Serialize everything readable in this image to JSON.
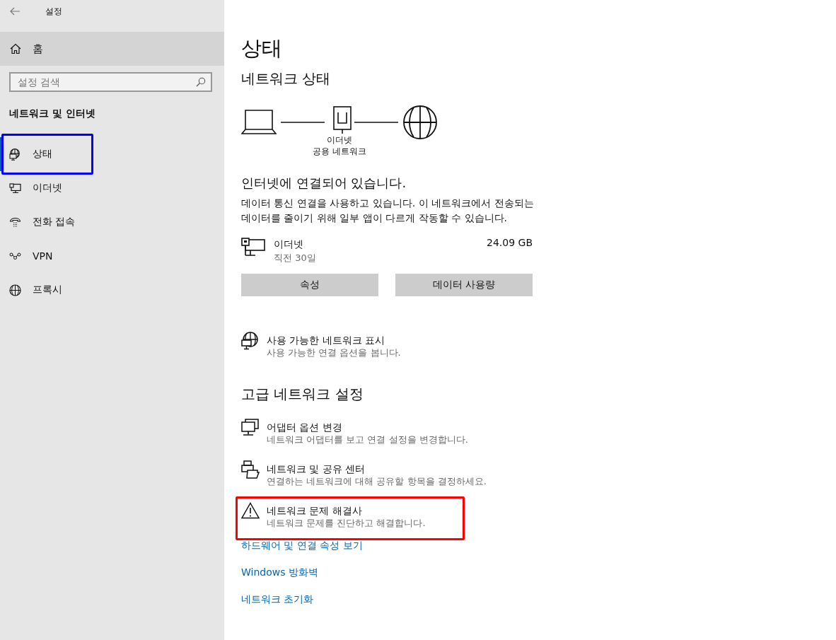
{
  "window": {
    "title": "설정"
  },
  "sidebar": {
    "home": {
      "label": "홈",
      "selected": true
    },
    "search": {
      "placeholder": "설정 검색"
    },
    "section_title": "네트워크 및 인터넷",
    "items": [
      {
        "label": "상태",
        "kind": "status",
        "selected": true,
        "highlighted": true
      },
      {
        "label": "이더넷",
        "kind": "ethernet",
        "selected": false,
        "highlighted": false
      },
      {
        "label": "전화 접속",
        "kind": "dialup",
        "selected": false,
        "highlighted": false
      },
      {
        "label": "VPN",
        "kind": "vpn",
        "selected": false,
        "highlighted": false
      },
      {
        "label": "프록시",
        "kind": "proxy",
        "selected": false,
        "highlighted": false
      }
    ]
  },
  "page": {
    "title": "상태",
    "network_status": {
      "heading": "네트워크 상태",
      "adapter_name": "이더넷",
      "network_type": "공용 네트워크",
      "connection_message": "인터넷에 연결되어 있습니다.",
      "description": "데이터 통신 연결을 사용하고 있습니다. 이 네트워크에서 전송되는 데이터를 줄이기 위해 일부 앱이 다르게 작동할 수 있습니다.",
      "usage": {
        "name": "이더넷",
        "period": "직전 30일",
        "amount": "24.09 GB"
      },
      "buttons": [
        "속성",
        "데이터 사용량"
      ]
    },
    "show_networks": {
      "title": "사용 가능한 네트워크 표시",
      "subtitle": "사용 가능한 연결 옵션을 봅니다."
    },
    "advanced": {
      "heading": "고급 네트워크 설정",
      "items": [
        {
          "kind": "adapter",
          "title": "어댑터 옵션 변경",
          "subtitle": "네트워크 어댑터를 보고 연결 설정을 변경합니다.",
          "highlighted": false
        },
        {
          "kind": "sharing",
          "title": "네트워크 및 공유 센터",
          "subtitle": "연결하는 네트워크에 대해 공유할 항목을 결정하세요.",
          "highlighted": false
        },
        {
          "kind": "troubleshoot",
          "title": "네트워크 문제 해결사",
          "subtitle": "네트워크 문제를 진단하고 해결합니다.",
          "highlighted": true
        }
      ],
      "links": [
        "하드웨어 및 연결 속성 보기",
        "Windows 방화벽",
        "네트워크 초기화"
      ]
    }
  }
}
